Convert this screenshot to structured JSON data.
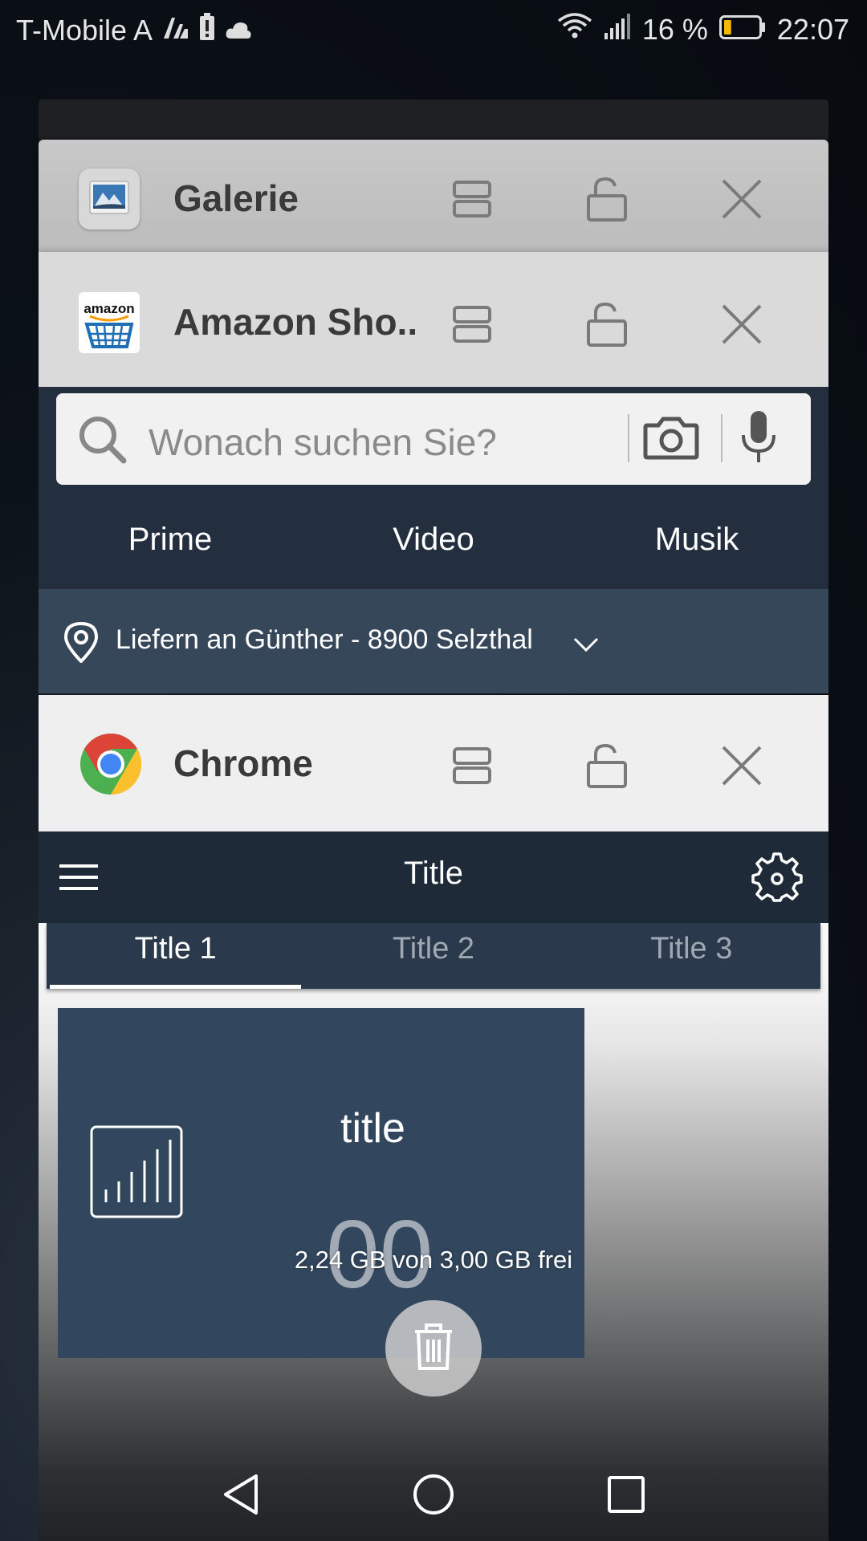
{
  "status_bar": {
    "carrier": "T-Mobile A",
    "battery_percent": "16 %",
    "time": "22:07",
    "battery_color": "#f5b800"
  },
  "recents": [
    {
      "app": "Galerie",
      "icon": "gallery-icon"
    },
    {
      "app": "Amazon Sho..",
      "icon": "amazon-icon"
    },
    {
      "app": "Chrome",
      "icon": "chrome-icon"
    }
  ],
  "amazon": {
    "search_placeholder": "Wonach suchen Sie?",
    "nav": [
      "Prime",
      "Video",
      "Musik"
    ],
    "deliver_to": "Liefern an Günther - 8900 Selzthal"
  },
  "chrome_page": {
    "toolbar_title": "Title",
    "tabs": [
      "Title 1",
      "Title 2",
      "Title 3"
    ],
    "active_tab": 0,
    "card_title": "title",
    "card_value": "00"
  },
  "memory_text": "2,24 GB von 3,00 GB frei",
  "colors": {
    "amazon_dark": "#232f3e",
    "amazon_deliver": "#37475a",
    "app_toolbar": "#1f2a38",
    "stat_card": "#32475e"
  }
}
